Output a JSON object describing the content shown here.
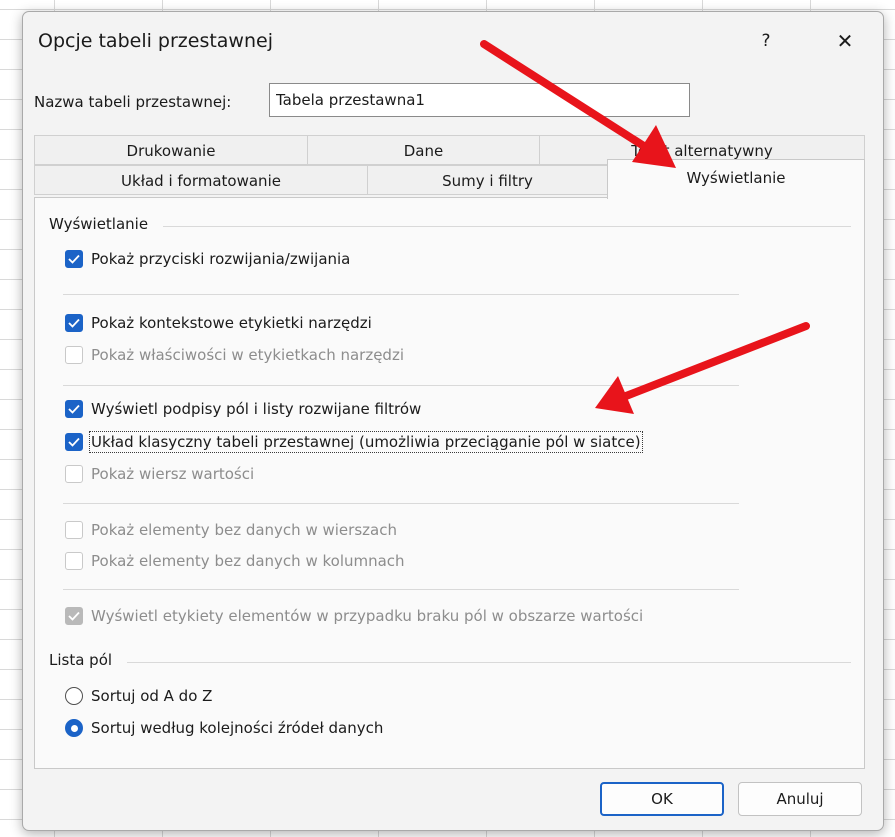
{
  "dialog": {
    "title": "Opcje tabeli przestawnej",
    "help_label": "?",
    "close_label": "✕"
  },
  "name_field": {
    "label": "Nazwa tabeli przestawnej:",
    "value": "Tabela przestawna1"
  },
  "tabs_row1": [
    {
      "label": "Drukowanie"
    },
    {
      "label": "Dane"
    },
    {
      "label": "Tekst alternatywny"
    }
  ],
  "tabs_row2": [
    {
      "label": "Układ i formatowanie"
    },
    {
      "label": "Sumy i filtry"
    },
    {
      "label": "Wyświetlanie"
    }
  ],
  "display_group": {
    "title": "Wyświetlanie",
    "options": [
      {
        "label": "Pokaż przyciski rozwijania/zwijania",
        "checked": true,
        "enabled": true
      },
      {
        "label": "Pokaż kontekstowe etykietki narzędzi",
        "checked": true,
        "enabled": true
      },
      {
        "label": "Pokaż właściwości w etykietkach narzędzi",
        "checked": false,
        "enabled": false
      },
      {
        "label": "Wyświetl podpisy pól i listy rozwijane filtrów",
        "checked": true,
        "enabled": true
      },
      {
        "label": "Układ klasyczny tabeli przestawnej (umożliwia przeciąganie pól w siatce)",
        "checked": true,
        "enabled": true
      },
      {
        "label": "Pokaż wiersz wartości",
        "checked": false,
        "enabled": false
      },
      {
        "label": "Pokaż elementy bez danych w wierszach",
        "checked": false,
        "enabled": false
      },
      {
        "label": "Pokaż elementy bez danych w kolumnach",
        "checked": false,
        "enabled": false
      },
      {
        "label": "Wyświetl etykiety elementów w przypadku braku pól w obszarze wartości",
        "checked": true,
        "enabled": false
      }
    ]
  },
  "field_list_group": {
    "title": "Lista pól",
    "options": [
      {
        "label": "Sortuj od A do Z",
        "selected": false
      },
      {
        "label": "Sortuj według kolejności źródeł danych",
        "selected": true
      }
    ]
  },
  "buttons": {
    "ok_label": "OK",
    "cancel_label": "Anuluj"
  },
  "colors": {
    "accent": "#1b63c7",
    "annotation_arrow": "#e8141b"
  }
}
